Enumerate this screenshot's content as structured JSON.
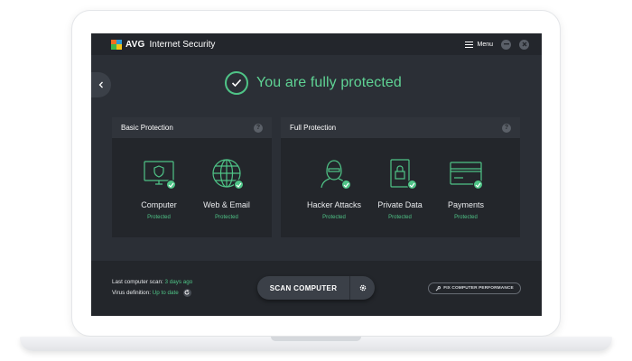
{
  "app": {
    "brand": "AVG",
    "product": "Internet Security",
    "menu_label": "Menu",
    "logo_colors": [
      "#f26e21",
      "#2c9bd6",
      "#3db74b",
      "#f2c418"
    ]
  },
  "status": {
    "text": "You are fully protected",
    "color": "#5fd394"
  },
  "panels": {
    "basic": {
      "title": "Basic Protection",
      "help": "?",
      "items": [
        {
          "title": "Computer",
          "status": "Protected",
          "icon": "monitor-shield-icon"
        },
        {
          "title": "Web & Email",
          "status": "Protected",
          "icon": "globe-icon"
        }
      ]
    },
    "full": {
      "title": "Full Protection",
      "help": "?",
      "items": [
        {
          "title": "Hacker Attacks",
          "status": "Protected",
          "icon": "hacker-icon"
        },
        {
          "title": "Private Data",
          "status": "Protected",
          "icon": "lock-document-icon"
        },
        {
          "title": "Payments",
          "status": "Protected",
          "icon": "credit-card-icon"
        }
      ]
    }
  },
  "bottom": {
    "last_scan_label": "Last computer scan:",
    "last_scan_value": "3 days ago",
    "virus_def_label": "Virus definition:",
    "virus_def_value": "Up to date",
    "scan_button": "SCAN COMPUTER",
    "fix_button": "FIX COMPUTER PERFORMANCE"
  },
  "colors": {
    "accent_green": "#4fc487",
    "screen_bg": "#2b2f36",
    "panel_bg": "#23262b"
  }
}
